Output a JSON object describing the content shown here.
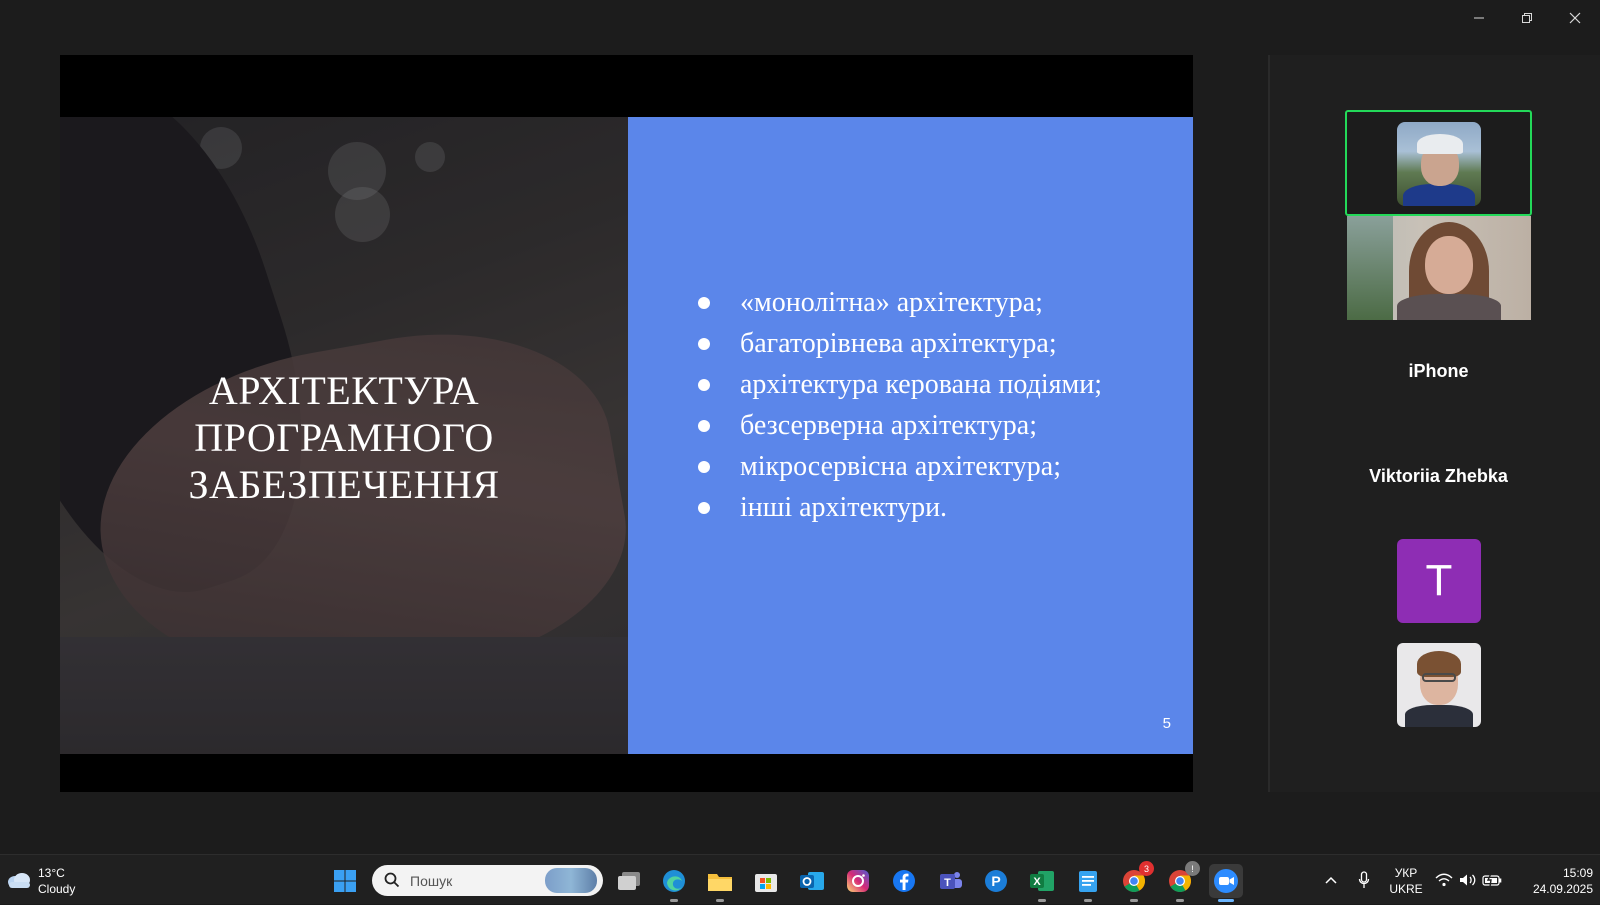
{
  "window": {
    "controls": {
      "minimize": "—",
      "restore": "❐",
      "close": "✕"
    }
  },
  "slide": {
    "title_lines": [
      "АРХІТЕКТУРА",
      "ПРОГРАМНОГО",
      "ЗАБЕЗПЕЧЕННЯ"
    ],
    "bullets": [
      "«монолітна» архітектура;",
      " багаторівнева архітектура;",
      "архітектура керована подіями;",
      "безсерверна архітектура;",
      "мікросервісна архітектура;",
      "інші архітектури."
    ],
    "page_number": "5",
    "panel_color": "#5b86ea"
  },
  "gallery": {
    "active_speaker_border": "#23d959",
    "participants": [
      {
        "name": "iPhone"
      },
      {
        "name": "Viktoriia Zhebka"
      },
      {
        "avatar_letter": "T",
        "avatar_color": "#8e2db4"
      }
    ]
  },
  "taskbar": {
    "weather": {
      "temp": "13°C",
      "condition": "Cloudy",
      "icon": "cloud-icon"
    },
    "search": {
      "placeholder": "Пошук"
    },
    "apps": [
      {
        "name": "windows-start-icon"
      },
      {
        "name": "task-view-icon"
      },
      {
        "name": "edge-icon"
      },
      {
        "name": "file-explorer-icon"
      },
      {
        "name": "microsoft-store-icon"
      },
      {
        "name": "outlook-icon"
      },
      {
        "name": "instagram-icon"
      },
      {
        "name": "facebook-icon"
      },
      {
        "name": "teams-icon"
      },
      {
        "name": "picsart-icon"
      },
      {
        "name": "excel-icon"
      },
      {
        "name": "notepad-icon"
      },
      {
        "name": "chrome-icon",
        "badge": "3"
      },
      {
        "name": "chrome-profile-icon",
        "badge": "!"
      },
      {
        "name": "zoom-icon"
      }
    ],
    "tray": {
      "language": [
        "УКР",
        "UKRE"
      ],
      "time": "15:09",
      "date": "24.09.2025"
    }
  }
}
